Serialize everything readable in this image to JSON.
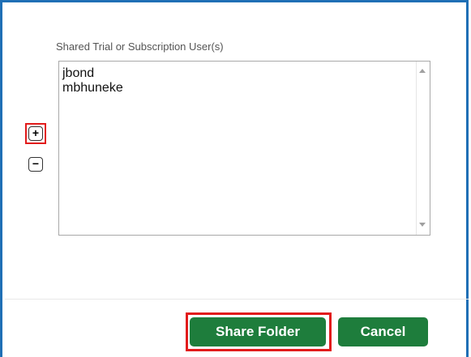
{
  "dialog": {
    "users_label": "Shared Trial or Subscription User(s)",
    "users": [
      "jbond",
      "mbhuneke"
    ],
    "add_symbol": "+",
    "remove_symbol": "−"
  },
  "footer": {
    "share_label": "Share Folder",
    "cancel_label": "Cancel"
  },
  "colors": {
    "frame": "#1f6fb5",
    "primary_button": "#1e7d3c",
    "highlight": "#e21b1b"
  },
  "icons": {
    "add": "plus-icon",
    "remove": "minus-icon",
    "scroll_up": "scroll-up-arrow-icon",
    "scroll_down": "scroll-down-arrow-icon"
  }
}
